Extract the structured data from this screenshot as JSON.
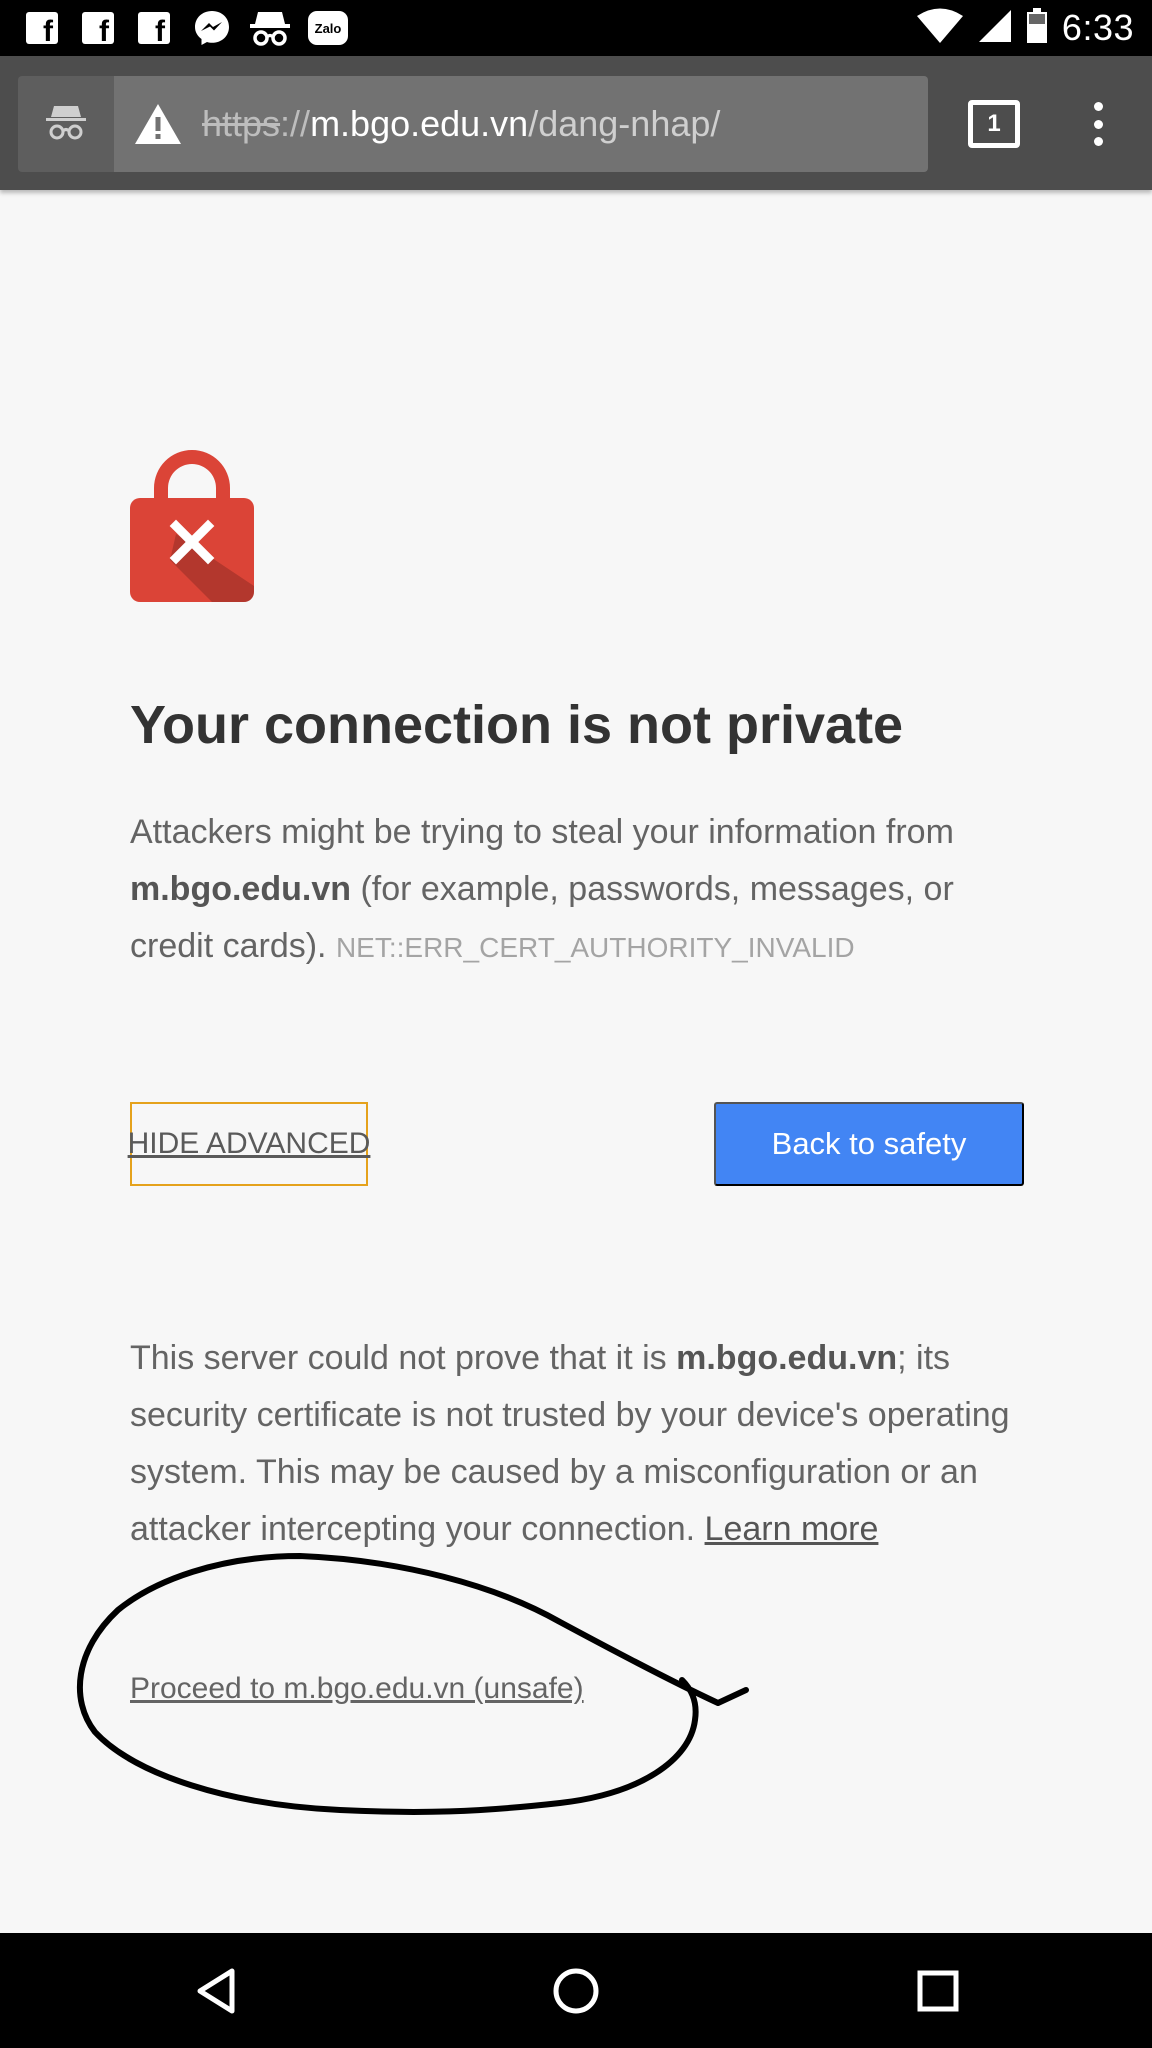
{
  "status_bar": {
    "time": "6:33",
    "notification_icons": [
      "facebook-icon",
      "facebook-icon",
      "facebook-icon",
      "messenger-icon",
      "incognito-icon",
      "zalo-icon"
    ],
    "zalo_label": "Zalo",
    "facebook_glyph": "f"
  },
  "toolbar": {
    "url_scheme": "https",
    "url_separator": "://",
    "url_host": "m.bgo.edu.vn",
    "url_path": "/dang-nhap/",
    "tab_count": "1"
  },
  "interstitial": {
    "title": "Your connection is not private",
    "intro_before": "Attackers might be trying to steal your information from ",
    "intro_host": "m.bgo.edu.vn",
    "intro_after": " (for example, passwords, messages, or credit cards). ",
    "error_code": "NET::ERR_CERT_AUTHORITY_INVALID",
    "hide_advanced_label": "HIDE ADVANCED",
    "back_to_safety_label": "Back to safety",
    "details_before": "This server could not prove that it is ",
    "details_host": "m.bgo.edu.vn",
    "details_after": "; its security certificate is not trusted by your device's operating system. This may be caused by a misconfiguration or an attacker intercepting your connection. ",
    "learn_more_label": "Learn more",
    "proceed_label": "Proceed to m.bgo.edu.vn (unsafe)"
  },
  "colors": {
    "lock_red": "#db4437",
    "accent_blue": "#4285f4",
    "focus_outline": "#e5a21c"
  }
}
